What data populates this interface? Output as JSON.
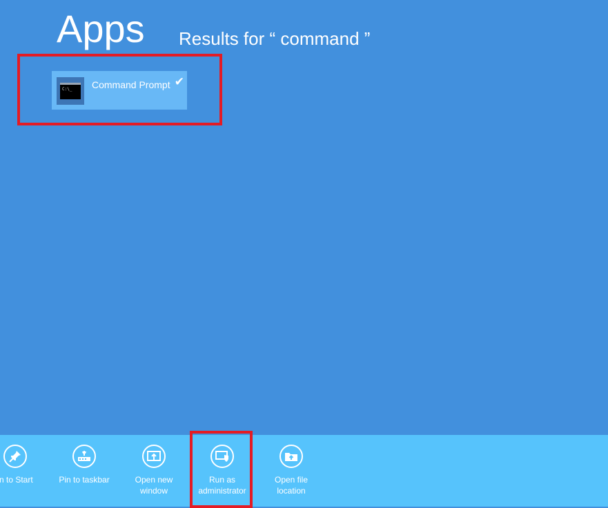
{
  "header": {
    "title": "Apps",
    "results_label": "Results for “ command ”"
  },
  "results": [
    {
      "label": "Command Prompt",
      "icon": "command-prompt-icon",
      "icon_text": "C:\\_",
      "checked": true
    }
  ],
  "app_bar": {
    "commands": [
      {
        "label": "in to Start",
        "icon": "pin-icon"
      },
      {
        "label": "Pin to taskbar",
        "icon": "taskbar-pin-icon"
      },
      {
        "label": "Open new\nwindow",
        "icon": "new-window-icon"
      },
      {
        "label": "Run as\nadministrator",
        "icon": "shield-icon"
      },
      {
        "label": "Open file\nlocation",
        "icon": "folder-open-icon"
      }
    ]
  },
  "colors": {
    "background": "#4290dd",
    "app_bar": "#56c3fc",
    "tile_selected": "#68b8f6",
    "highlight": "#e41b24"
  }
}
